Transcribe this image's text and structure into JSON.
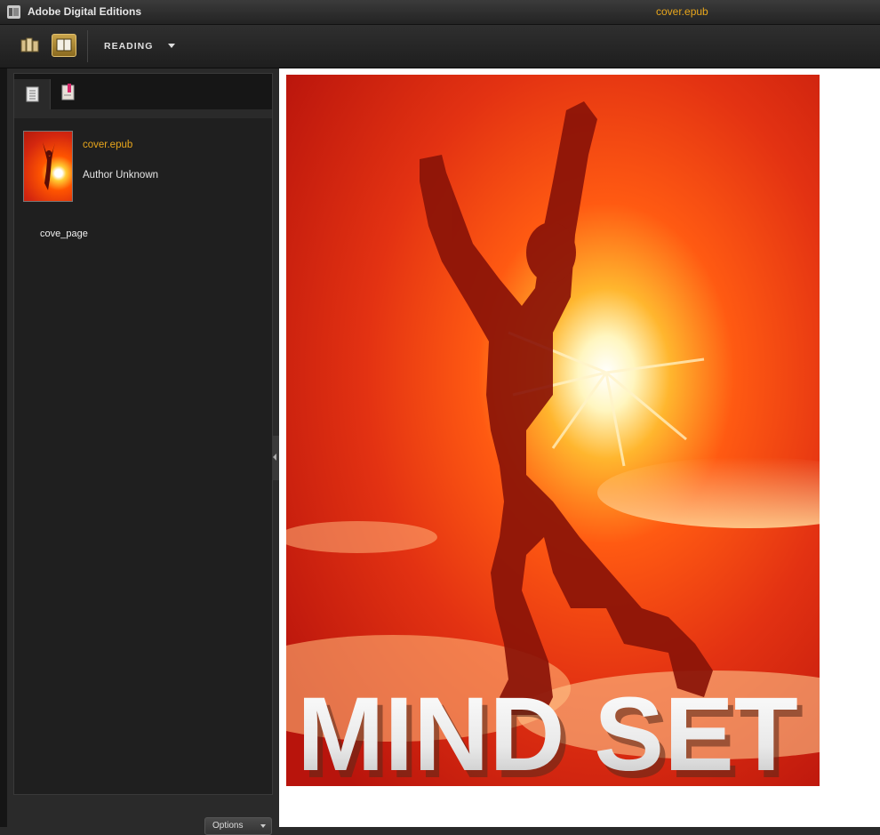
{
  "window": {
    "app_title": "Adobe Digital Editions",
    "document_title": "cover.epub"
  },
  "toolbar": {
    "view_mode_label": "READING"
  },
  "sidebar": {
    "book": {
      "title": "cover.epub",
      "author": "Author Unknown"
    },
    "toc": [
      {
        "label": "cove_page"
      }
    ],
    "options_label": "Options"
  },
  "cover": {
    "text": "MIND SET"
  },
  "colors": {
    "accent": "#e8a61c",
    "panel": "#1f1f1f",
    "pane": "#ffffff"
  }
}
